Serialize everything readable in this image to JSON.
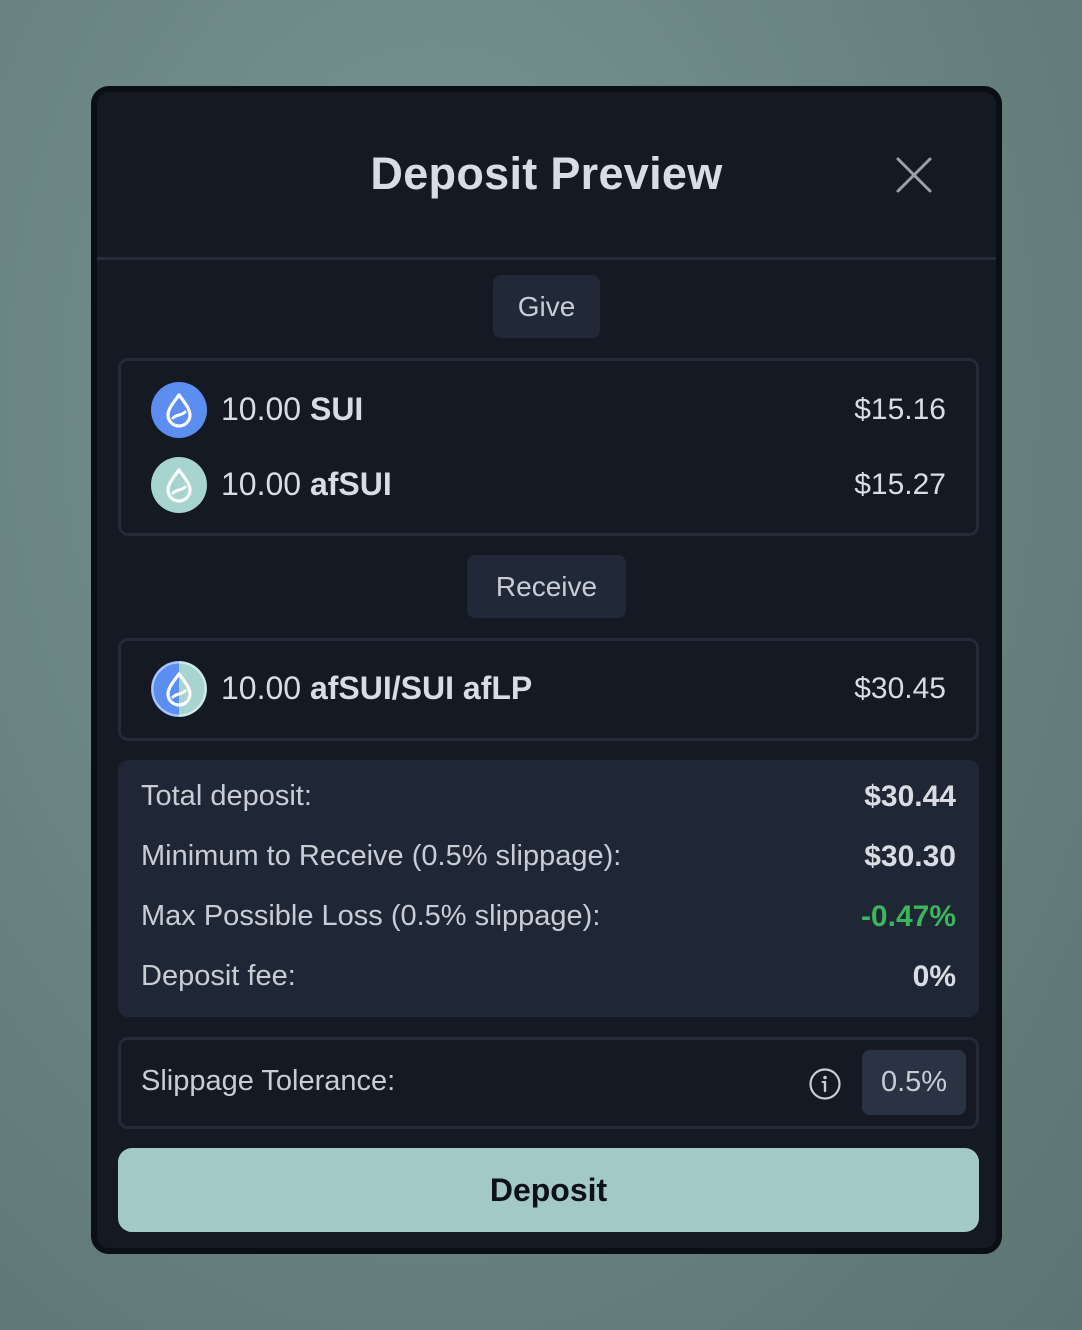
{
  "modal": {
    "title": "Deposit Preview"
  },
  "give": {
    "label": "Give",
    "tokens": [
      {
        "amount": "10.00",
        "symbol": "SUI",
        "usd": "$15.16",
        "icon": "sui-coin-icon"
      },
      {
        "amount": "10.00",
        "symbol": "afSUI",
        "usd": "$15.27",
        "icon": "afsui-coin-icon"
      }
    ]
  },
  "receive": {
    "label": "Receive",
    "tokens": [
      {
        "amount": "10.00",
        "symbol": "afSUI/SUI afLP",
        "usd": "$30.45",
        "icon": "aflp-coin-icon"
      }
    ]
  },
  "summary": {
    "rows": [
      {
        "label": "Total deposit:",
        "value": "$30.44"
      },
      {
        "label": "Minimum to Receive (0.5% slippage):",
        "value": "$30.30"
      },
      {
        "label": "Max Possible Loss (0.5% slippage):",
        "value": "-0.47%"
      },
      {
        "label": "Deposit fee:",
        "value": "0%"
      }
    ]
  },
  "slippage": {
    "label": "Slippage Tolerance:",
    "value": "0.5%"
  },
  "actions": {
    "deposit_label": "Deposit"
  },
  "colors": {
    "accent": "#a3c9c7",
    "sui_blue": "#5b8ef0",
    "afsui_teal": "#a8d4cf",
    "positive_green": "#3db55b"
  }
}
